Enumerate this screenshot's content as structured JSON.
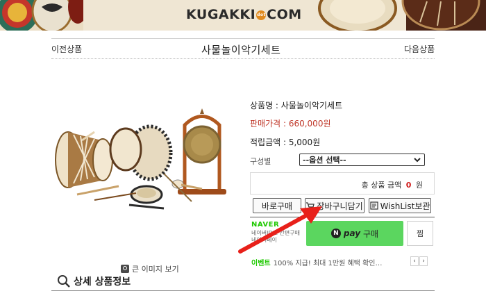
{
  "banner": {
    "logo_text": "KUGAKKI",
    "logo_dot": "dot",
    "logo_suffix": "COM"
  },
  "nav": {
    "prev": "이전상품",
    "next": "다음상품",
    "title": "사물놀이악기세트"
  },
  "product": {
    "name_label": "상품명 : 사물놀이악기세트",
    "price_label": "판매가격 : 660,000원",
    "point_label": "적립금액 : 5,000원",
    "option_label": "구성별",
    "option_selected": "--옵션 선택--",
    "total_prefix": "총 상품 금액",
    "total_value": "0",
    "total_unit": "원"
  },
  "buttons": {
    "buy_now": "바로구매",
    "add_to_cart": "장바구니담기",
    "wishlist": "WishList보관"
  },
  "naver": {
    "logo": "NAVER",
    "desc": "네이버ID로 간편구매 네이버페이",
    "pay_n": "N",
    "pay_word": "pay",
    "pay_action": "구매",
    "zzim": "찜",
    "event_tag": "이벤트",
    "event_text": "100% 지급! 최대 1만원 혜택 확인…",
    "prev": "‹",
    "next": "›"
  },
  "image": {
    "zoom_label": "큰 이미지 보기"
  },
  "detail": {
    "title": "상세 상품정보"
  },
  "colors": {
    "price_red": "#c0392b",
    "naver_green": "#1ec800",
    "npay_button": "#5bd65f",
    "arrow_red": "#e8201a"
  },
  "icons": {
    "cart": "cart-icon",
    "wish": "wishlist-icon",
    "zoom": "zoom-icon",
    "detail": "magnifier-icon",
    "select": "chevron-down-icon"
  }
}
